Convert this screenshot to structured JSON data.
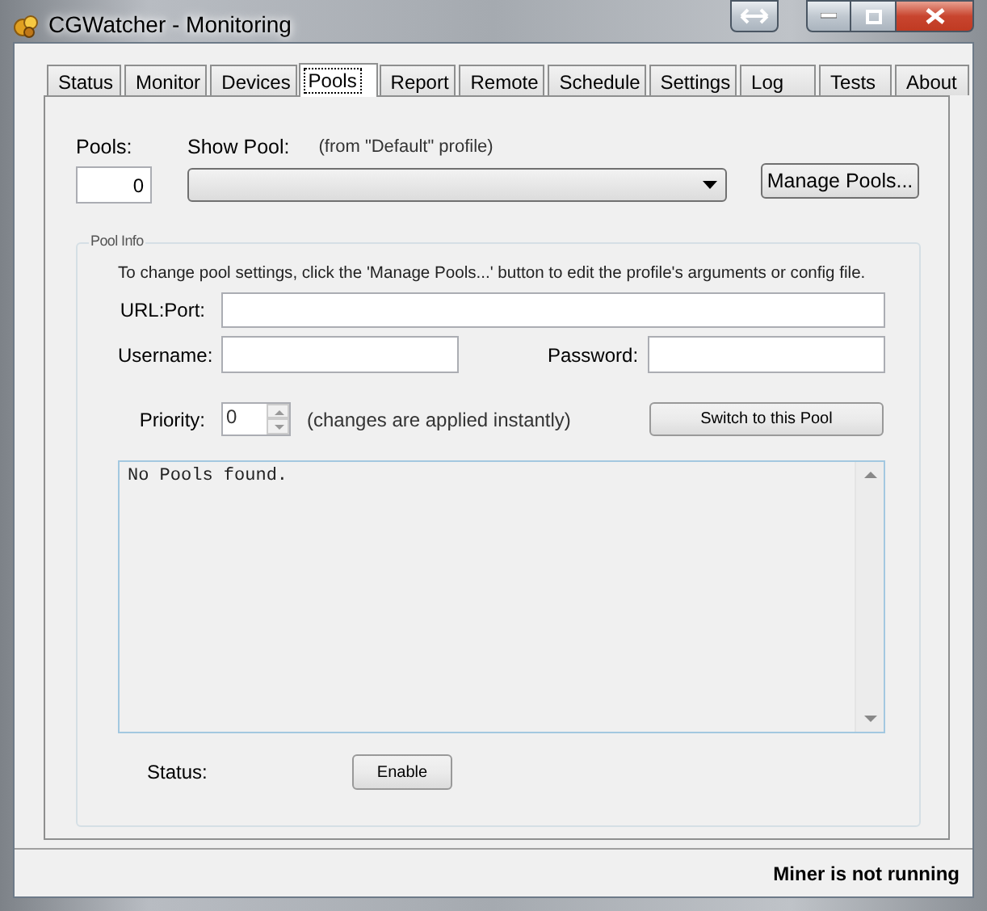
{
  "window": {
    "title": "CGWatcher - Monitoring"
  },
  "tabs": [
    {
      "label": "Status",
      "selected": false
    },
    {
      "label": "Monitor",
      "selected": false
    },
    {
      "label": "Devices",
      "selected": false
    },
    {
      "label": "Pools",
      "selected": true
    },
    {
      "label": "Report",
      "selected": false
    },
    {
      "label": "Remote",
      "selected": false
    },
    {
      "label": "Schedule",
      "selected": false
    },
    {
      "label": "Settings",
      "selected": false
    },
    {
      "label": "Log",
      "selected": false
    },
    {
      "label": "Tests",
      "selected": false
    },
    {
      "label": "About",
      "selected": false
    }
  ],
  "pools_count": {
    "label": "Pools:",
    "value": "0"
  },
  "show_pool": {
    "label": "Show Pool:",
    "note": "(from \"Default\" profile)"
  },
  "manage_button": "Manage Pools...",
  "pool_info": {
    "title": "Pool Info",
    "hint": "To change pool settings, click the 'Manage Pools...' button to edit the profile's arguments or config file.",
    "url_label": "URL:Port:",
    "username_label": "Username:",
    "password_label": "Password:",
    "priority_label": "Priority:",
    "priority_value": "0",
    "priority_note": "(changes are applied instantly)",
    "switch_button": "Switch to this Pool",
    "log": "No Pools found.",
    "status_label": "Status:",
    "enable_button": "Enable"
  },
  "status_bar": "Miner is not running"
}
